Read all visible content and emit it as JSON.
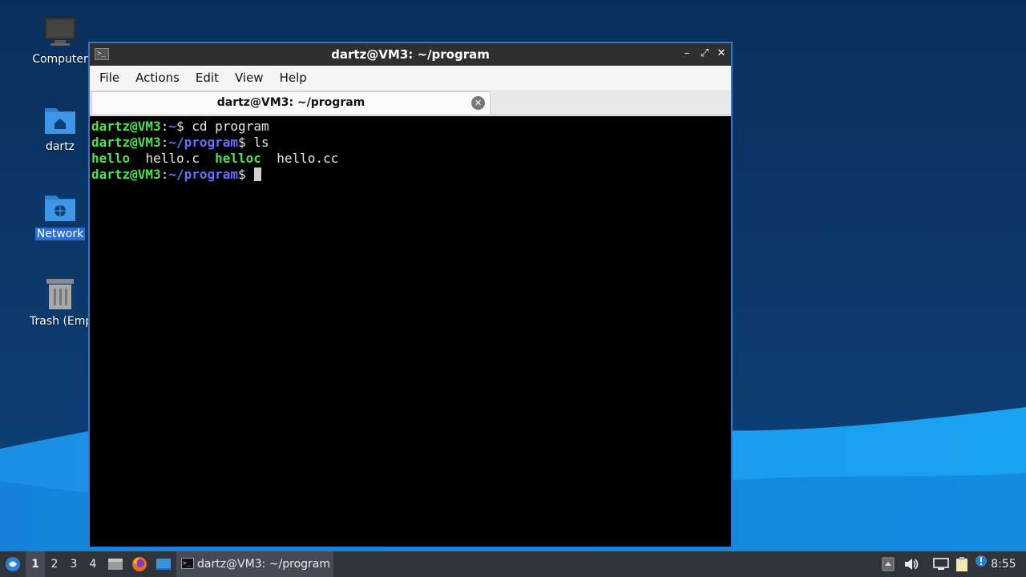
{
  "desktop": {
    "icons": [
      {
        "label": "Computer",
        "icon": "computer-icon",
        "selected": false
      },
      {
        "label": "dartz",
        "icon": "home-folder-icon",
        "selected": false
      },
      {
        "label": "Network",
        "icon": "network-folder-icon",
        "selected": true
      },
      {
        "label": "Trash (Empt",
        "icon": "trash-icon",
        "selected": false
      }
    ]
  },
  "window": {
    "title": "dartz@VM3: ~/program",
    "controls": {
      "minimize": "–",
      "maximize": "⤢",
      "close": "✕"
    },
    "menu": [
      "File",
      "Actions",
      "Edit",
      "View",
      "Help"
    ],
    "tab": {
      "title": "dartz@VM3: ~/program",
      "close": "✕"
    }
  },
  "terminal": {
    "lines": [
      {
        "user": "dartz@VM3",
        "sep": ":",
        "path": "~",
        "prompt": "$ ",
        "cmd": "cd program"
      },
      {
        "user": "dartz@VM3",
        "sep": ":",
        "path": "~/program",
        "prompt": "$ ",
        "cmd": "ls"
      },
      {
        "output": [
          "hello",
          "hello.c",
          "helloc",
          "hello.cc"
        ]
      },
      {
        "user": "dartz@VM3",
        "sep": ":",
        "path": "~/program",
        "prompt": "$ ",
        "cmd": ""
      }
    ],
    "colors": {
      "user": "#4fe34f",
      "path": "#6b6bff",
      "text": "#e6e6e6",
      "background": "#000000"
    }
  },
  "taskbar": {
    "workspaces": [
      "1",
      "2",
      "3",
      "4"
    ],
    "active_workspace": "1",
    "launchers": [
      "start-menu-icon",
      "file-manager-icon",
      "firefox-icon",
      "desktop-icon"
    ],
    "task_title": "dartz@VM3: ~/program",
    "tray": [
      "show-desktop-icon",
      "volume-icon",
      "network-icon",
      "clipboard-icon",
      "notification-icon"
    ],
    "clock": "8:55"
  }
}
